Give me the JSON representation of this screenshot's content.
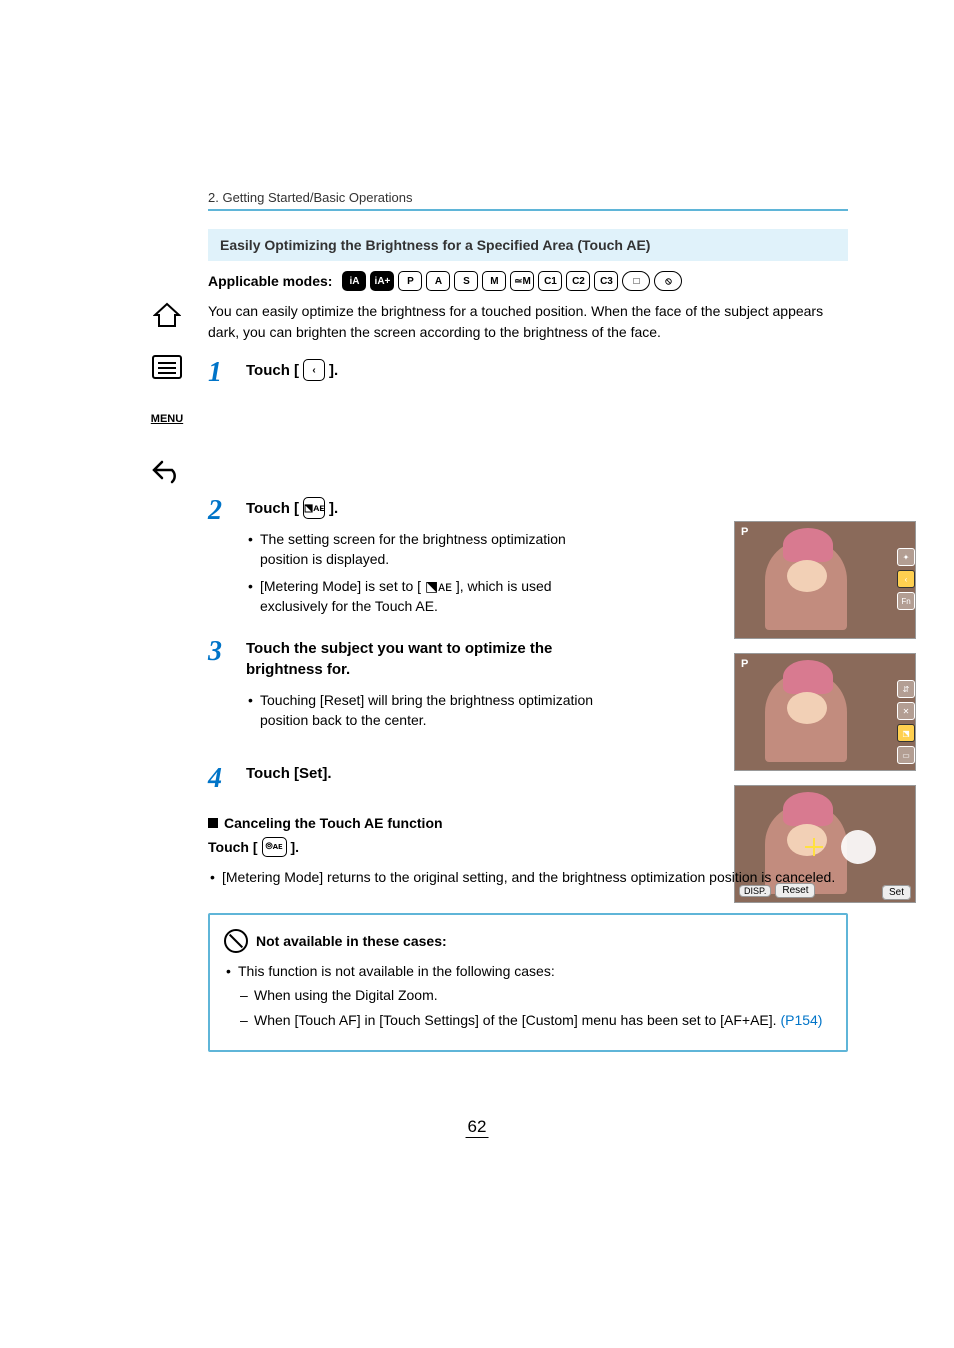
{
  "breadcrumb": "2. Getting Started/Basic Operations",
  "section_title": "Easily Optimizing the Brightness for a Specified Area (Touch AE)",
  "modes_label": "Applicable modes:",
  "modes": [
    "iA",
    "iA+",
    "P",
    "A",
    "S",
    "M",
    "≃M",
    "C1",
    "C2",
    "C3",
    "□",
    "⦸"
  ],
  "intro": "You can easily optimize the brightness for a touched position. When the face of the subject appears dark, you can brighten the screen according to the brightness of the face.",
  "steps": [
    {
      "num": "1",
      "head": "Touch [",
      "icon": "‹",
      "tail": "]."
    },
    {
      "num": "2",
      "head": "Touch [",
      "icon": "⬔ᴀᴇ",
      "tail": "].",
      "bullets": [
        "The setting screen for the brightness optimization position is displayed.",
        "[Metering Mode] is set to [ ⬔ᴀᴇ ], which is used exclusively for the Touch AE."
      ]
    },
    {
      "num": "3",
      "head": "Touch the subject you want to optimize the brightness for.",
      "bullets": [
        "Touching [Reset] will bring the brightness optimization position back to the center."
      ]
    },
    {
      "num": "4",
      "head": "Touch [Set]."
    }
  ],
  "cancel_heading": "Canceling the Touch AE function",
  "cancel_touch": "Touch [",
  "cancel_icon": "⦾ᴀᴇ",
  "cancel_tail": "].",
  "cancel_bullet": "[Metering Mode] returns to the original setting, and the brightness optimization position is canceled.",
  "note_heading": "Not available in these cases:",
  "note_intro": "This function is not available in the following cases:",
  "note_items": [
    "When using the Digital Zoom.",
    "When [Touch AF] in [Touch Settings] of the [Custom] menu has been set to [AF+AE]."
  ],
  "note_link": "(P154)",
  "page_num": "62",
  "photo": {
    "badge": "P",
    "disp": "DISP.",
    "reset": "Reset",
    "set": "Set",
    "fn": "Fn"
  },
  "sidebar": {
    "menu": "MENU"
  }
}
